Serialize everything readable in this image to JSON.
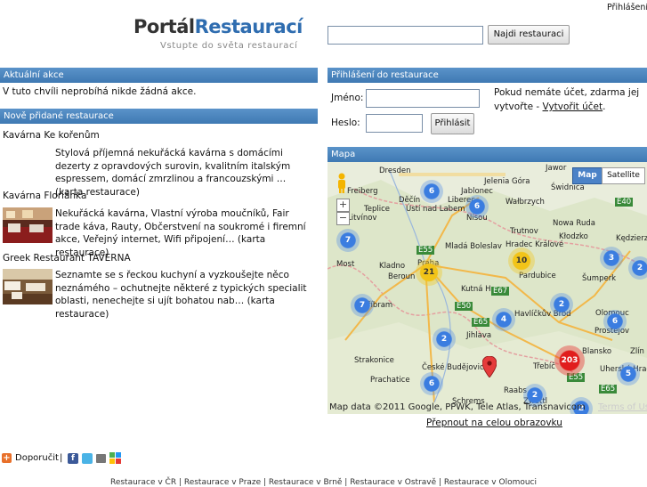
{
  "header": {
    "login_link": "Přihlášení",
    "logo_part1": "Portál",
    "logo_part2": "Restaurací",
    "tagline": "Vstupte do světa restaurací",
    "search_value": "",
    "search_button": "Najdi restauraci"
  },
  "actions": {
    "title": "Aktuální akce",
    "text": "V tuto chvíli neprobíhá nikde žádná akce."
  },
  "new_restaurants": {
    "title": "Nově přidané restaurace",
    "items": [
      {
        "name": "Kavárna Ke kořenům",
        "description": "Stylová příjemná nekuřácká kavárna s domácími dezerty z opravdových surovin, kvalitním italským espressem, domácí zmrzlinou a francouzskými …",
        "card_link": "(karta restaurace)"
      },
      {
        "name": "Kavárna Floriánka",
        "description": "Nekuřácká kavárna, Vlastní výroba moučníků, Fair trade káva, Rauty, Občerstvení na soukromé i firemní akce, Veřejný internet, Wifi připojení…",
        "card_link": "(karta restaurace)"
      },
      {
        "name": "Greek Restaurant TAVERNA",
        "description": "Seznamte se s řeckou kuchyní a vyzkoušejte něco neznámého – ochutnejte některé z typických specialit oblasti, nenechejte si ujít bohatou nab…",
        "card_link": "(karta restaurace)"
      }
    ]
  },
  "login": {
    "title": "Přihlášení do restaurace",
    "name_label": "Jméno:",
    "password_label": "Heslo:",
    "name_value": "",
    "password_value": "",
    "submit": "Přihlásit",
    "info_text": "Pokud nemáte účet, zdarma jej vytvořte - ",
    "create_link": "Vytvořit účet",
    "info_end": "."
  },
  "map": {
    "title": "Mapa",
    "type_map": "Map",
    "type_satellite": "Satellite",
    "attribution": "Map data ©2011 Google, PPWK, Tele Atlas, Transnavicom",
    "terms": "Terms of Use",
    "fullscreen_link": "Přepnout na celou obrazovku",
    "cities": [
      "Dresden",
      "Jelenia Góra",
      "Jawor",
      "Wałbrzych",
      "Świdnica",
      "Liberec",
      "Freiberg",
      "Teplice",
      "Ústí nad Labem",
      "Litvínov",
      "Děčín",
      "Nisou",
      "Nowa Ruda",
      "Trutnov",
      "Kłodzko",
      "Kędzierzyn",
      "Mladá Boleslav",
      "Hradec Králové",
      "Kladno",
      "Praha",
      "Pardubice",
      "Beroun",
      "Kutná Hora",
      "Šumperk",
      "Olomouc",
      "Jihlava",
      "Havlíčkův Brod",
      "Příbram",
      "Blansko",
      "Prostějov",
      "Zlín",
      "Strakonice",
      "Třebíč",
      "České Budějovice",
      "Schrems",
      "Raabs",
      "Prachatice",
      "Zwettl",
      "Uherské Hradiště",
      "Jablonec",
      "Most"
    ],
    "clusters": [
      "6",
      "6",
      "7",
      "21",
      "10",
      "3",
      "7",
      "2",
      "4",
      "6",
      "2",
      "203",
      "2",
      "6",
      "5",
      "2",
      "2"
    ],
    "road_labels": [
      "E55",
      "E67",
      "E65",
      "E50",
      "E40",
      "E55",
      "E65"
    ]
  },
  "footer": {
    "recommend": "Doporučit",
    "separator": "|",
    "links": "Restaurace v ČR | Restaurace v Praze | Restaurace v Brně | Restaurace v Ostravě | Restaurace v Olomouci"
  },
  "colors": {
    "bar_blue": "#4a86c0",
    "logo_blue": "#2f6db0",
    "cluster_blue": "#3b7de0",
    "cluster_red": "#e11d1d",
    "cluster_yellow": "#f2c418"
  }
}
